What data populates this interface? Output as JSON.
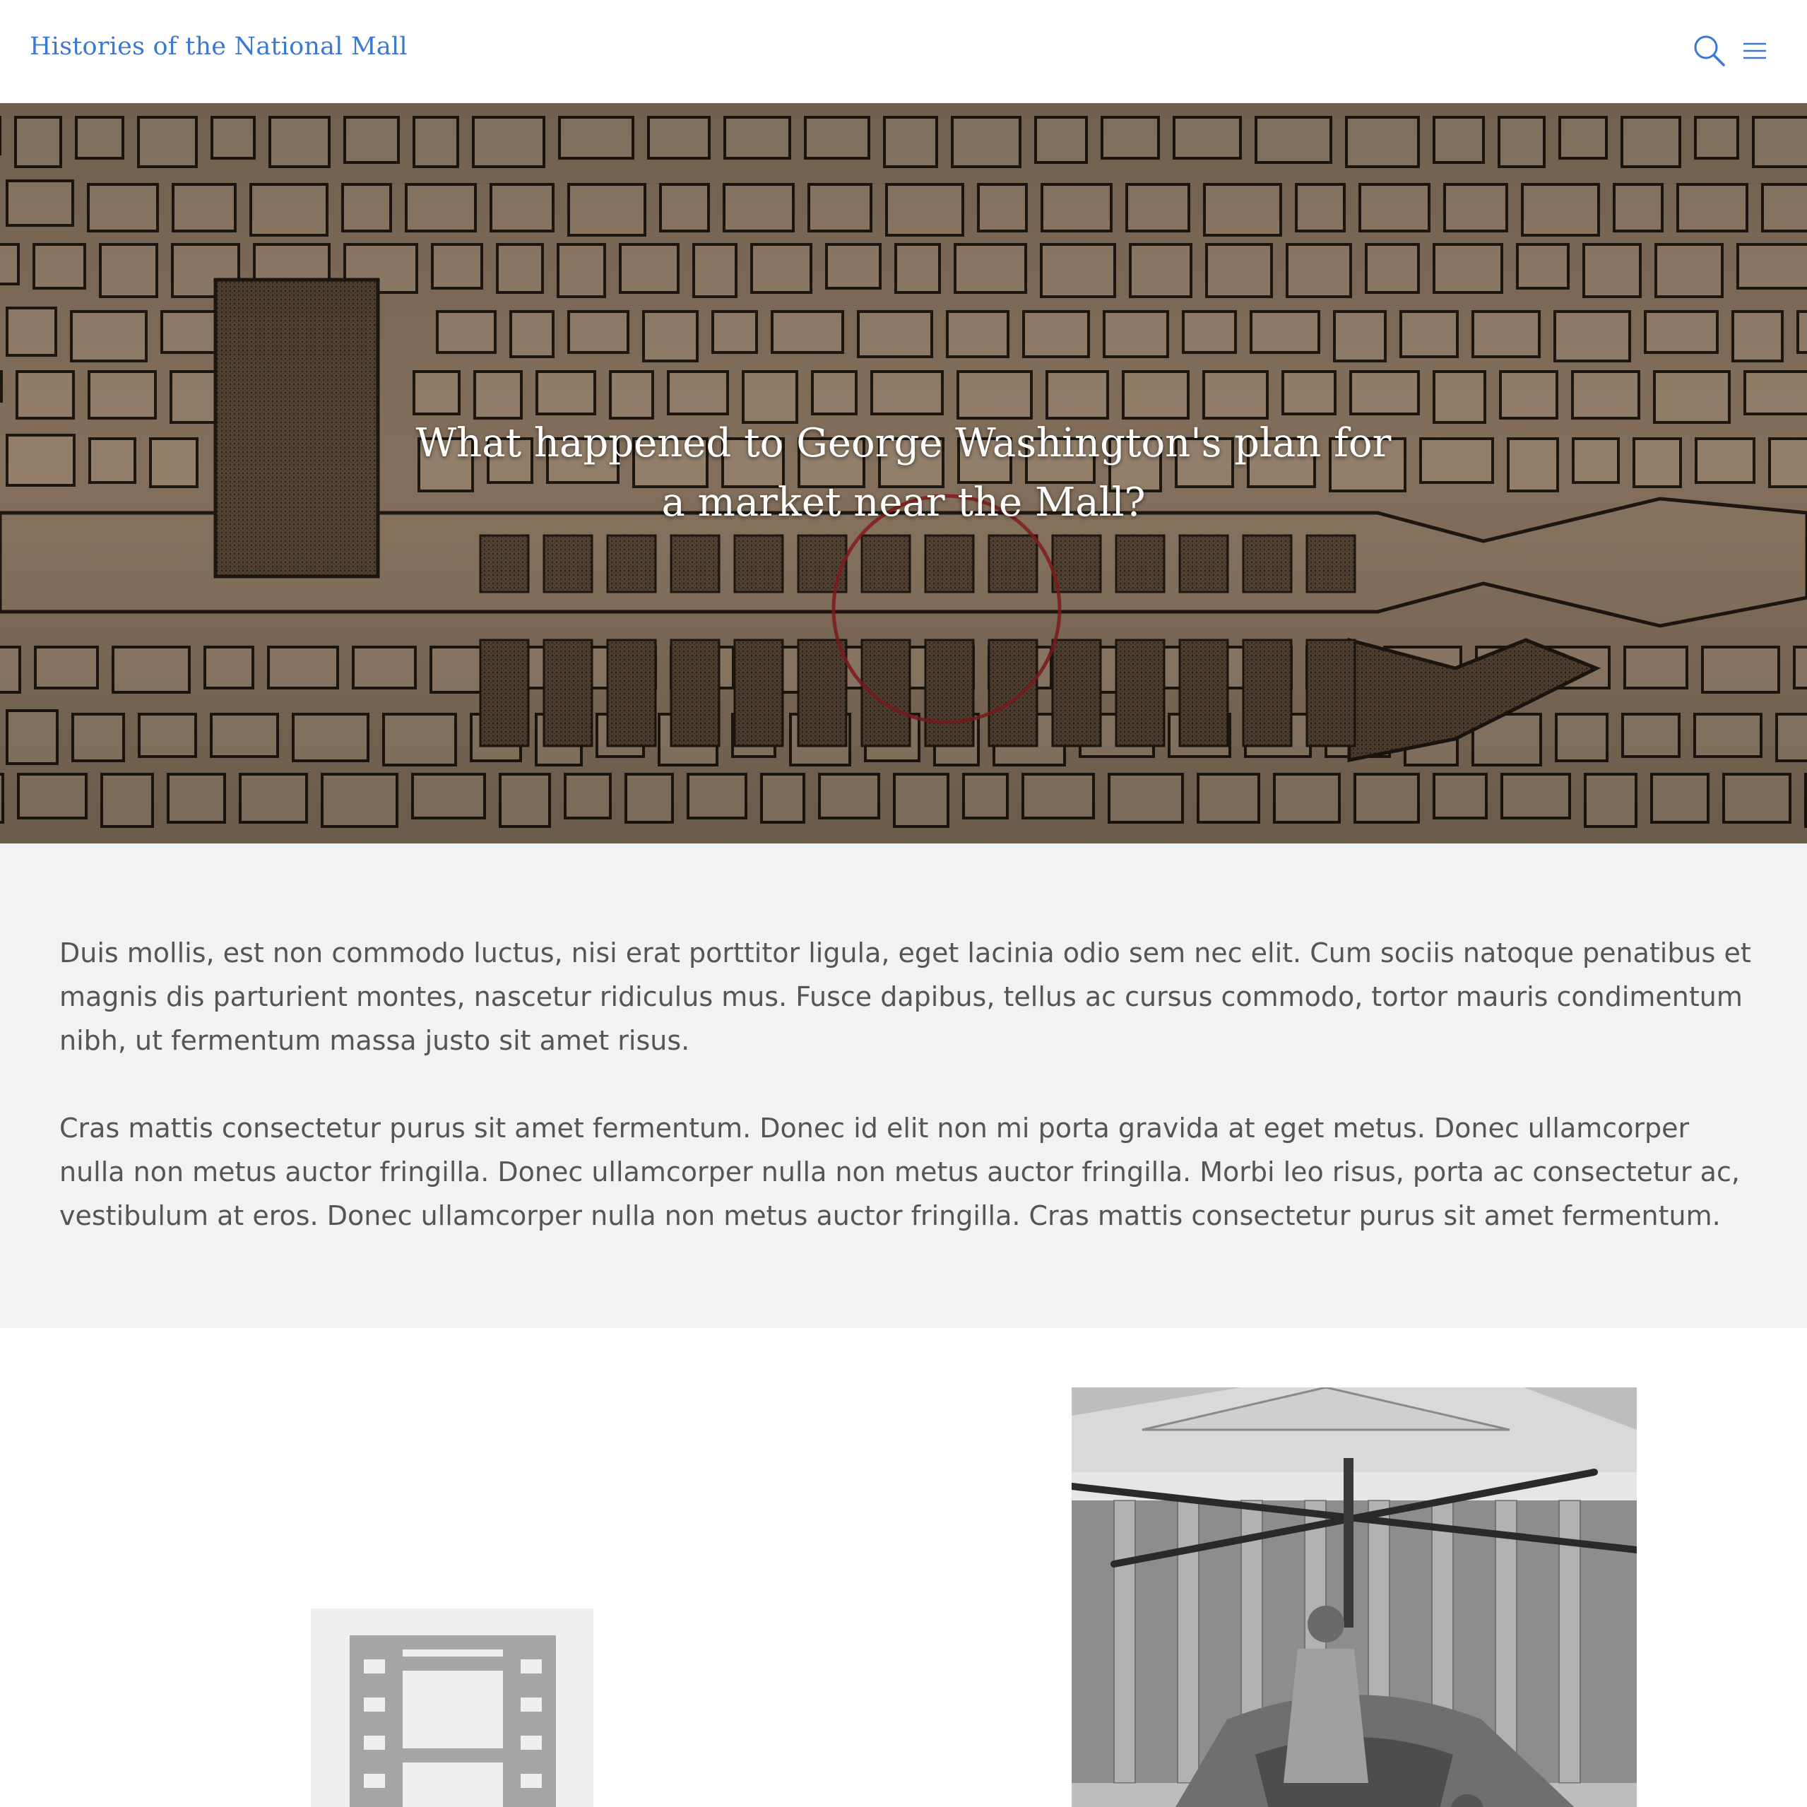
{
  "header": {
    "site_title": "Histories of the National Mall",
    "search_icon": "search-icon",
    "menu_icon": "hamburger-menu-icon",
    "accent_color": "#3b78d4"
  },
  "hero": {
    "title": "What happened to George Washington's plan for a market near the Mall?",
    "background": "historic-map-of-washington-dc"
  },
  "intro": {
    "paragraphs": [
      "Duis mollis, est non commodo luctus, nisi erat porttitor ligula, eget lacinia odio sem nec elit. Cum sociis natoque penatibus et magnis dis parturient montes, nascetur ridiculus mus. Fusce dapibus, tellus ac cursus commodo, tortor mauris condimentum nibh, ut fermentum massa justo sit amet risus.",
      "Cras mattis consectetur purus sit amet fermentum. Donec id elit non mi porta gravida at eget metus. Donec ullamcorper nulla non metus auctor fringilla. Donec ullamcorper nulla non metus auctor fringilla. Morbi leo risus, porta ac consectetur ac, vestibulum at eros. Donec ullamcorper nulla non metus auctor fringilla. Cras mattis consectetur purus sit amet fermentum."
    ]
  },
  "media": {
    "video_icon": "film-strip-icon",
    "photo_subject": "autogiro-in-front-of-columned-building-black-and-white-photo"
  }
}
